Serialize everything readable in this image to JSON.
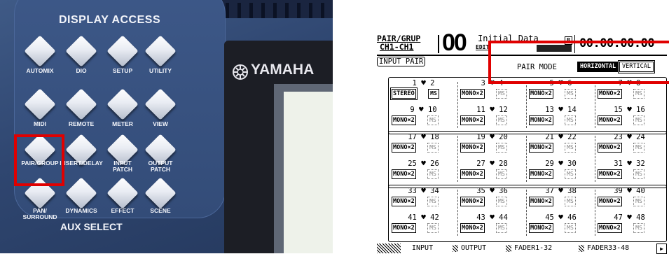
{
  "console": {
    "section_title": "DISPLAY ACCESS",
    "aux_title": "AUX SELECT",
    "brand": "YAMAHA",
    "buttons": [
      {
        "label": "AUTOMIX"
      },
      {
        "label": "DIO"
      },
      {
        "label": "SETUP"
      },
      {
        "label": "UTILITY"
      },
      {
        "label": "MIDI"
      },
      {
        "label": "REMOTE"
      },
      {
        "label": "METER"
      },
      {
        "label": "VIEW"
      },
      {
        "label": "PAIR/GROUP"
      },
      {
        "label": "INSERT/DELAY"
      },
      {
        "label": "INPUT\nPATCH"
      },
      {
        "label": "OUTPUT\nPATCH"
      },
      {
        "label": "PAN/\nSURROUND"
      },
      {
        "label": "DYNAMICS"
      },
      {
        "label": "EFFECT"
      },
      {
        "label": "SCENE"
      }
    ],
    "highlighted_button": "PAIR/GROUP",
    "highlight_color": "#e00000"
  },
  "lcd": {
    "title_line1": "PAIR/GRUP",
    "title_line2": "CH1-CH1",
    "scene_number": "00",
    "scene_name": "Initial Data",
    "edit_flag": "EDIT",
    "b_mark": "B",
    "timecode": "00:00:00.00",
    "page_tab": "INPUT PAIR",
    "pair_mode_label": "PAIR MODE",
    "horizontal_label": "HORIZONTAL",
    "vertical_label": "VERTICAL",
    "pair_mode_selected": "HORIZONTAL",
    "heart_icon": "♥",
    "blocks": [
      {
        "columns": [
          {
            "top": {
              "a": "1",
              "b": "2",
              "button": "STEREO",
              "ms": "MS"
            },
            "bottom": {
              "a": "9",
              "b": "10",
              "button": "MONO×2",
              "ms": "MS"
            }
          },
          {
            "top": {
              "a": "3",
              "b": "4",
              "button": "MONO×2",
              "ms": "MS"
            },
            "bottom": {
              "a": "11",
              "b": "12",
              "button": "MONO×2",
              "ms": "MS"
            }
          },
          {
            "top": {
              "a": "5",
              "b": "6",
              "button": "MONO×2",
              "ms": "MS"
            },
            "bottom": {
              "a": "13",
              "b": "14",
              "button": "MONO×2",
              "ms": "MS"
            }
          },
          {
            "top": {
              "a": "7",
              "b": "8",
              "button": "MONO×2",
              "ms": "MS"
            },
            "bottom": {
              "a": "15",
              "b": "16",
              "button": "MONO×2",
              "ms": "MS"
            }
          }
        ]
      },
      {
        "columns": [
          {
            "top": {
              "a": "17",
              "b": "18",
              "button": "MONO×2",
              "ms": "MS"
            },
            "bottom": {
              "a": "25",
              "b": "26",
              "button": "MONO×2",
              "ms": "MS"
            }
          },
          {
            "top": {
              "a": "19",
              "b": "20",
              "button": "MONO×2",
              "ms": "MS"
            },
            "bottom": {
              "a": "27",
              "b": "28",
              "button": "MONO×2",
              "ms": "MS"
            }
          },
          {
            "top": {
              "a": "21",
              "b": "22",
              "button": "MONO×2",
              "ms": "MS"
            },
            "bottom": {
              "a": "29",
              "b": "30",
              "button": "MONO×2",
              "ms": "MS"
            }
          },
          {
            "top": {
              "a": "23",
              "b": "24",
              "button": "MONO×2",
              "ms": "MS"
            },
            "bottom": {
              "a": "31",
              "b": "32",
              "button": "MONO×2",
              "ms": "MS"
            }
          }
        ]
      },
      {
        "columns": [
          {
            "top": {
              "a": "33",
              "b": "34",
              "button": "MONO×2",
              "ms": "MS"
            },
            "bottom": {
              "a": "41",
              "b": "42",
              "button": "MONO×2",
              "ms": "MS"
            }
          },
          {
            "top": {
              "a": "35",
              "b": "36",
              "button": "MONO×2",
              "ms": "MS"
            },
            "bottom": {
              "a": "43",
              "b": "44",
              "button": "MONO×2",
              "ms": "MS"
            }
          },
          {
            "top": {
              "a": "37",
              "b": "38",
              "button": "MONO×2",
              "ms": "MS"
            },
            "bottom": {
              "a": "45",
              "b": "46",
              "button": "MONO×2",
              "ms": "MS"
            }
          },
          {
            "top": {
              "a": "39",
              "b": "40",
              "button": "MONO×2",
              "ms": "MS"
            },
            "bottom": {
              "a": "47",
              "b": "48",
              "button": "MONO×2",
              "ms": "MS"
            }
          }
        ]
      }
    ],
    "tabs": [
      "INPUT",
      "OUTPUT",
      "FADER1-32",
      "FADER33-48"
    ],
    "tab_arrow": "▶"
  }
}
